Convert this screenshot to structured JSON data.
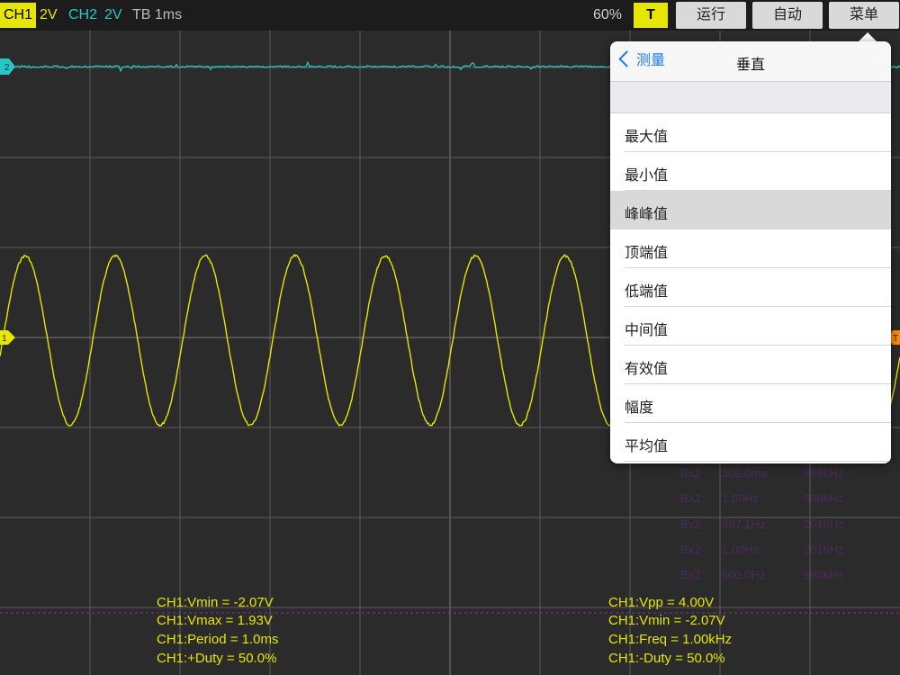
{
  "topbar": {
    "ch1_label": "CH1",
    "ch1_scale": "2V",
    "ch2_label": "CH2",
    "ch2_scale": "2V",
    "timebase": "TB 1ms",
    "zoom": "60%",
    "trigger_button": "T",
    "run_button": "运行",
    "auto_button": "自动",
    "menu_button": "菜单"
  },
  "markers": {
    "ch2": "2",
    "ch1": "1",
    "trigger": "T"
  },
  "colors": {
    "ch1": "#e6e600",
    "ch2": "#27c7c7",
    "trigger": "#ff8c00",
    "grid": "#5c5c5c",
    "accent": "#1a7cf5"
  },
  "popover": {
    "back_label": "测量",
    "title": "垂直",
    "items": [
      "最大值",
      "最小值",
      "峰峰值",
      "顶端值",
      "低端值",
      "中间值",
      "有效值",
      "幅度",
      "平均值"
    ],
    "selected_index": 2
  },
  "measurements": {
    "left": [
      "CH1:Vmin = -2.07V",
      "CH1:Vmax = 1.93V",
      "CH1:Period = 1.0ms",
      "CH1:+Duty = 50.0%"
    ],
    "right": [
      "CH1:Vpp = 4.00V",
      "CH1:Vmin = -2.07V",
      "CH1:Freq = 1.00kHz",
      "CH1:-Duty = 50.0%"
    ]
  },
  "ghost_readouts": [
    [
      "Bx2",
      "502.0ms",
      "998kHz"
    ],
    [
      "Bx2",
      "1.00Hz",
      "998kHz"
    ],
    [
      "Bx2",
      "997.1Hz",
      "2016Hz"
    ],
    [
      "Bx2",
      "1.00Hz",
      "2016Hz"
    ],
    [
      "Bx2",
      "600.0Hz",
      "998kHz"
    ]
  ],
  "waveform": {
    "ch1_frequency_khz": 1.0,
    "ch1_vmax": 1.93,
    "ch1_vmin": -2.07,
    "ch1_volts_per_div": 2,
    "ms_per_div": 1
  }
}
